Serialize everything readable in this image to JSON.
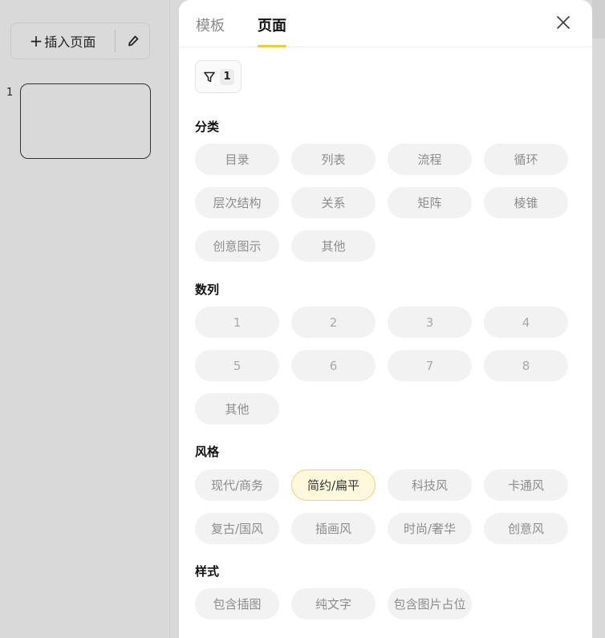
{
  "sidebar": {
    "insert_label": "插入页面",
    "insert_icon": "plus-icon",
    "edit_icon": "pencil-icon",
    "slides": [
      {
        "number": "1"
      }
    ]
  },
  "panel": {
    "tabs": [
      {
        "label": "模板",
        "active": false
      },
      {
        "label": "页面",
        "active": true
      }
    ],
    "close_icon": "close-icon",
    "filter": {
      "icon": "filter-icon",
      "count": "1"
    },
    "accent_color": "#f5cc2b",
    "sections": [
      {
        "title": "分类",
        "chips": [
          "目录",
          "列表",
          "流程",
          "循环",
          "层次结构",
          "关系",
          "矩阵",
          "棱锥",
          "创意图示",
          "其他"
        ]
      },
      {
        "title": "数列",
        "chips": [
          "1",
          "2",
          "3",
          "4",
          "5",
          "6",
          "7",
          "8",
          "其他"
        ]
      },
      {
        "title": "风格",
        "chips": [
          "现代/商务",
          "简约/扁平",
          "科技风",
          "卡通风",
          "复古/国风",
          "插画风",
          "时尚/奢华",
          "创意风"
        ],
        "selected": "简约/扁平"
      },
      {
        "title": "样式",
        "chips": [
          "包含插图",
          "纯文字",
          "包含图片占位"
        ]
      }
    ]
  }
}
